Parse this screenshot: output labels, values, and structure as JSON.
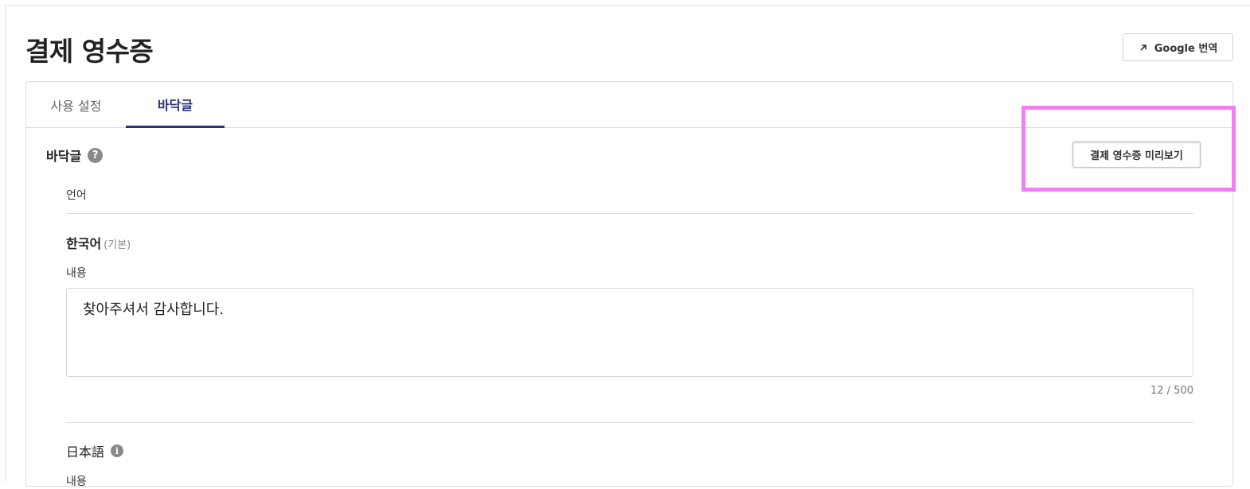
{
  "page": {
    "title": "결제 영수증",
    "translate_button": {
      "label": "Google 번역",
      "icon": "external-arrow-icon"
    }
  },
  "tabs": [
    {
      "label": "사용 설정",
      "active": false
    },
    {
      "label": "바닥글",
      "active": true
    }
  ],
  "section": {
    "title": "바닥글",
    "help_icon": "?",
    "preview_button": "결제 영수증 미리보기"
  },
  "language": {
    "label": "언어",
    "korean": {
      "name": "한국어",
      "sub": "(기본)",
      "content_label": "내용",
      "content_value": "찾아주셔서 감사합니다.",
      "counter": "12 / 500"
    },
    "japanese": {
      "name": "日本語",
      "info_icon": "i",
      "content_label": "내용"
    }
  },
  "colors": {
    "accent": "#2b2d7a",
    "highlight": "#f27ff0"
  }
}
